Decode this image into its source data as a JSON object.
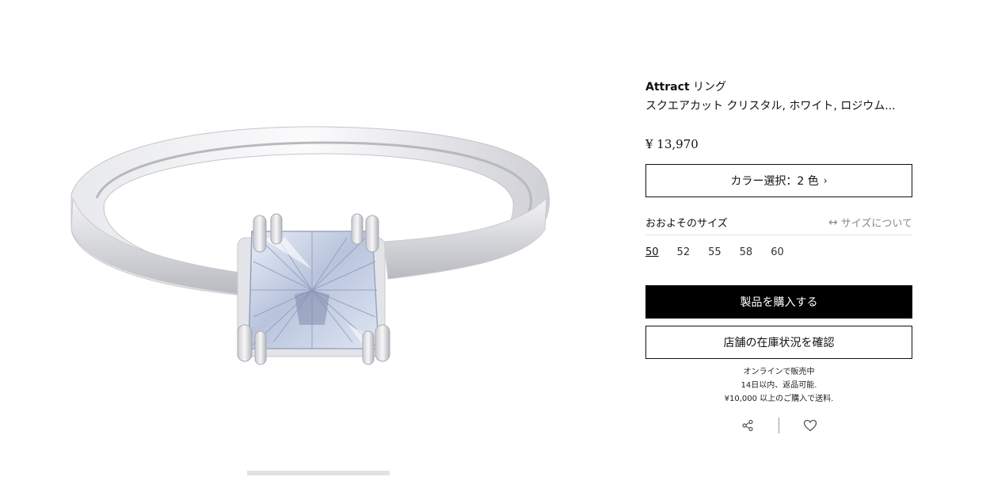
{
  "product": {
    "brand": "Attract",
    "name_suffix": " リング",
    "subtitle": "スクエアカット クリスタル, ホワイト, ロジウム...",
    "price": "¥ 13,970",
    "image_alt_icon": "ring-product-image"
  },
  "color_select": {
    "label": "カラー選択：2 色",
    "chevron": "›"
  },
  "size": {
    "label": "おおよそのサイズ",
    "guide_label": "サイズについて",
    "guide_icon": "↔",
    "options": [
      "50",
      "52",
      "55",
      "58",
      "60"
    ],
    "selected": "50"
  },
  "buttons": {
    "buy": "製品を購入する",
    "stock": "店舗の在庫状況を確認"
  },
  "info": {
    "line1": "オンラインで販売中",
    "line2": "14日以内、返品可能.",
    "line3": "¥10,000 以上のご購入で送料."
  },
  "actions": {
    "share_icon": "share-icon",
    "wishlist_icon": "heart-icon"
  },
  "colors": {
    "primary_button_bg": "#000000",
    "primary_button_text": "#ffffff",
    "muted_text": "#8a8a8a"
  }
}
